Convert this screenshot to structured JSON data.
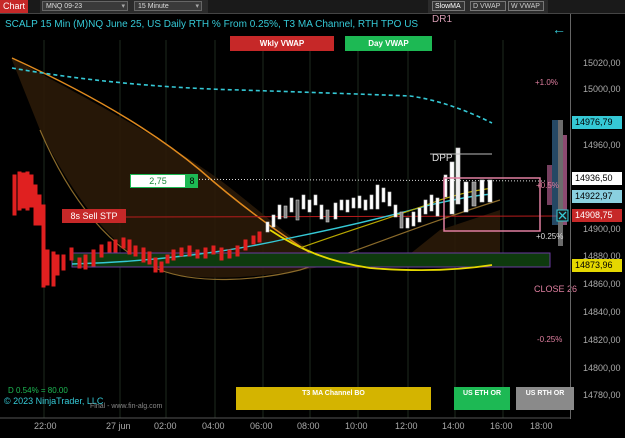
{
  "toolbar": {
    "chart_label": "Chart",
    "instrument": "MNQ 09-23",
    "interval": "15 Minute",
    "indicator": "SlowMA",
    "btn_d_vwap": "D VWAP",
    "btn_w_vwap": "W VWAP"
  },
  "chart": {
    "title": "SCALP 15 Min (M)NQ June 25, US Daily RTH % From 0.25%, T3 MA Channel, RTH TPO US",
    "dr_label": "DR1",
    "wkly_vwap_label": "Wkly VWAP",
    "day_vwap_label": "Day VWAP",
    "dpp_label": "DPP",
    "order_qty": "2,75",
    "order_count": "8",
    "sell_stop_label": "8s  Sell STP",
    "close_label": "CLOSE 26",
    "pct_plus_1": "+1.0%",
    "pct_plus_025_a": "+0.5%",
    "pct_plus_025_b": "+0.25%",
    "pct_minus_025": "-0.25%",
    "d_info": "D 0.54% = 80.00",
    "copyright": "© 2023 NinjaTrader, LLC",
    "watermark": "Final - www.fin-alg.com",
    "t3_label": "T3 MA Channel BO",
    "us_eth_label": "US ETH OR",
    "us_rth_label": "US RTH OR",
    "colors": {
      "accent": "#35c9d6",
      "wkly": "#c62828",
      "day": "#1db954",
      "t3": "#d4b400"
    }
  },
  "yaxis": {
    "ticks": [
      "15020,00",
      "15000,00",
      "14960,00",
      "14900,00",
      "14880,00",
      "14860,00",
      "14840,00",
      "14820,00",
      "14800,00",
      "14780,00"
    ],
    "tag_1": "14976,79",
    "tag_2": "14936,50",
    "tag_3": "14922,97",
    "tag_4": "14908,75",
    "tag_5": "14873,96"
  },
  "xaxis": {
    "ticks": [
      "22:00",
      "27 jun",
      "02:00",
      "04:00",
      "06:00",
      "08:00",
      "10:00",
      "12:00",
      "14:00",
      "16:00",
      "18:00"
    ]
  }
}
